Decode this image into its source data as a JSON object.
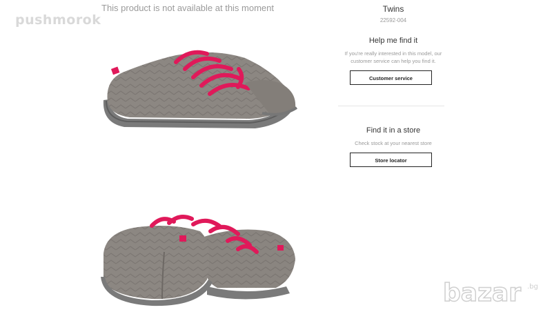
{
  "watermark": {
    "top_text": "pushmorok",
    "corner_logo": "bazar.bg"
  },
  "gallery": {
    "unavailable_text": "This product is not available at this moment"
  },
  "product": {
    "name": "Twins",
    "code": "22592-004"
  },
  "help": {
    "heading": "Help me find it",
    "text": "If you're really interested in this model, our customer service can help you find it.",
    "button_label": "Customer service"
  },
  "store": {
    "heading": "Find it in a store",
    "text": "Check stock at your nearest store",
    "button_label": "Store locator"
  },
  "colors": {
    "shoe_gray": "#8a8580",
    "lace_pink": "#e0195a",
    "sole_gray": "#7b7b7b"
  }
}
